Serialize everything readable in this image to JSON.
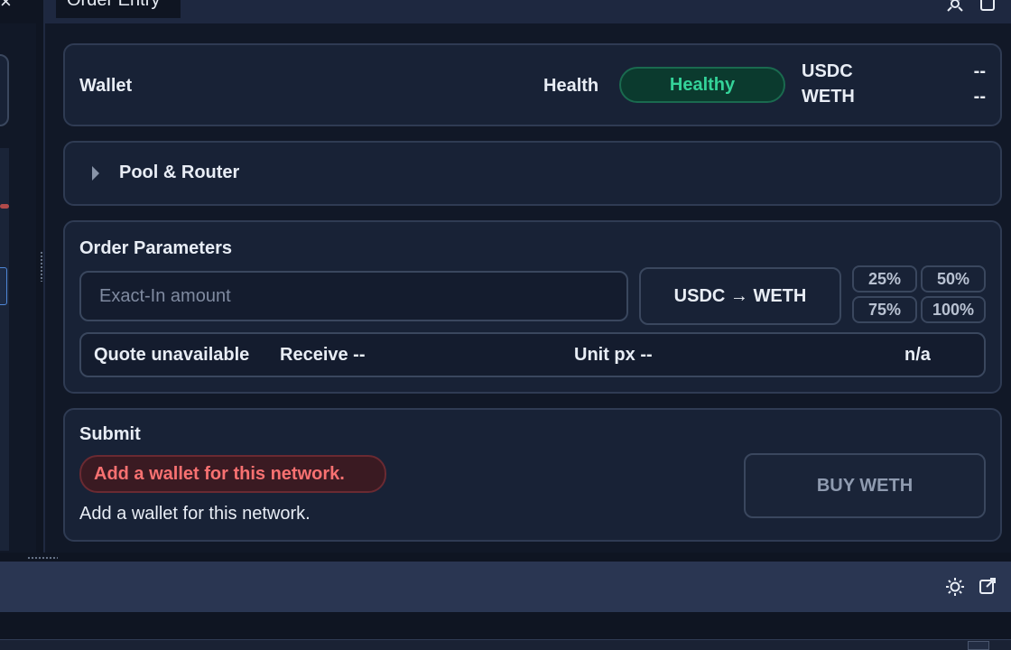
{
  "topbar": {
    "tab_title": "Order Entry",
    "icons": [
      "crosshair-icon",
      "window-icon"
    ]
  },
  "left_panel": {
    "close_glyph": "×"
  },
  "wallet": {
    "title": "Wallet",
    "health_label": "Health",
    "health_status": "Healthy",
    "balances": [
      {
        "asset": "USDC",
        "value": "--"
      },
      {
        "asset": "WETH",
        "value": "--"
      }
    ]
  },
  "pool": {
    "title": "Pool & Router"
  },
  "order": {
    "title": "Order Parameters",
    "amount_placeholder": "Exact-In amount",
    "amount_value": "",
    "direction_label": "USDC → WETH",
    "percent_buttons": [
      "25%",
      "50%",
      "75%",
      "100%"
    ],
    "quote": {
      "status": "Quote unavailable",
      "receive": "Receive --",
      "unit_px": "Unit px --",
      "na": "n/a"
    }
  },
  "submit": {
    "title": "Submit",
    "error_badge": "Add a wallet for this network.",
    "error_text": "Add a wallet for this network.",
    "buy_label": "BUY WETH"
  },
  "colors": {
    "background": "#0f1522",
    "card": "#182236",
    "healthy": "#34d399",
    "error": "#f87171"
  }
}
